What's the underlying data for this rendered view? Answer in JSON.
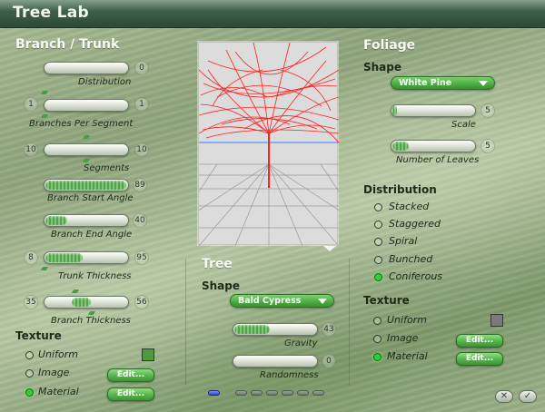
{
  "window": {
    "title": "Tree Lab"
  },
  "branch": {
    "heading": "Branch / Trunk",
    "distribution": {
      "label": "Distribution",
      "value": "0",
      "fill": 0.0
    },
    "branches_per_segment": {
      "label": "Branches Per Segment",
      "min": "1",
      "max": "1"
    },
    "segments": {
      "label": "Segments",
      "min": "10",
      "max": "10"
    },
    "branch_start_angle": {
      "label": "Branch Start Angle",
      "value": "89",
      "fill": 0.99
    },
    "branch_end_angle": {
      "label": "Branch End Angle",
      "value": "40",
      "fill": 0.27
    },
    "trunk_thickness": {
      "label": "Trunk Thickness",
      "min": "8",
      "max": "95",
      "fill": 0.46
    },
    "branch_thickness": {
      "label": "Branch Thickness",
      "min": "35",
      "max": "56",
      "fill_start": 0.33,
      "fill_end": 0.56
    },
    "texture": {
      "heading": "Texture",
      "options": [
        {
          "label": "Uniform",
          "selected": false
        },
        {
          "label": "Image",
          "selected": false
        },
        {
          "label": "Material",
          "selected": true
        }
      ],
      "swatch_color": "#4f9a3a",
      "edit_label": "Edit..."
    }
  },
  "tree": {
    "heading": "Tree",
    "shape_heading": "Shape",
    "shape_value": "Bald Cypress",
    "gravity": {
      "label": "Gravity",
      "value": "43",
      "fill": 0.43
    },
    "randomness": {
      "label": "Randomness",
      "value": "0",
      "fill": 0.0
    },
    "pages": 7,
    "active_page": 0
  },
  "foliage": {
    "heading": "Foliage",
    "shape_heading": "Shape",
    "shape_value": "White Pine",
    "scale": {
      "label": "Scale",
      "value": "5",
      "fill": 0.05
    },
    "leaves": {
      "label": "Number of Leaves",
      "value": "5",
      "fill": 0.2
    },
    "distribution_heading": "Distribution",
    "distribution_options": [
      {
        "label": "Stacked",
        "selected": false
      },
      {
        "label": "Staggered",
        "selected": false
      },
      {
        "label": "Spiral",
        "selected": false
      },
      {
        "label": "Bunched",
        "selected": false
      },
      {
        "label": "Coniferous",
        "selected": true
      }
    ],
    "texture": {
      "heading": "Texture",
      "options": [
        {
          "label": "Uniform",
          "selected": false
        },
        {
          "label": "Image",
          "selected": false
        },
        {
          "label": "Material",
          "selected": true
        }
      ],
      "swatch_color": "#7a7a7a",
      "edit_label": "Edit..."
    }
  },
  "footer": {
    "cancel_symbol": "✕",
    "ok_symbol": "✓"
  },
  "colors": {
    "accent": "#4fae46",
    "title_bar": "#3c5e47",
    "preview_branch": "#ff2020",
    "horizon": "#3a7cff"
  }
}
